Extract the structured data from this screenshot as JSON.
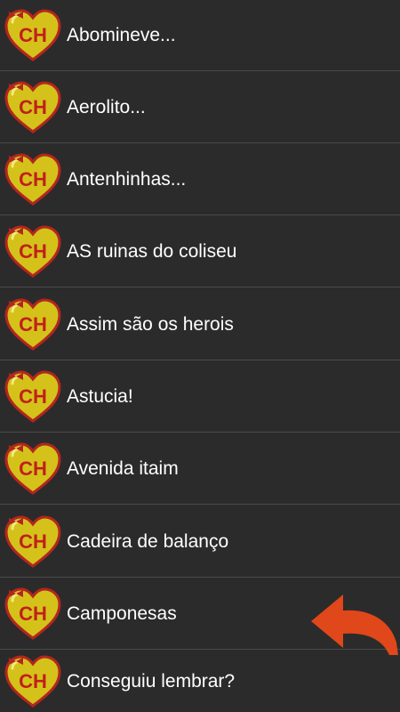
{
  "items": [
    {
      "label": "Abomineve...",
      "icon": "chapolin-heart-icon"
    },
    {
      "label": "Aerolito...",
      "icon": "chapolin-heart-icon"
    },
    {
      "label": "Antenhinhas...",
      "icon": "chapolin-heart-icon"
    },
    {
      "label": "AS ruinas do coliseu",
      "icon": "chapolin-heart-icon"
    },
    {
      "label": "Assim são os herois",
      "icon": "chapolin-heart-icon"
    },
    {
      "label": "Astucia!",
      "icon": "chapolin-heart-icon"
    },
    {
      "label": "Avenida itaim",
      "icon": "chapolin-heart-icon"
    },
    {
      "label": "Cadeira de balanço",
      "icon": "chapolin-heart-icon"
    },
    {
      "label": "Camponesas",
      "icon": "chapolin-heart-icon"
    },
    {
      "label": "Conseguiu lembrar?",
      "icon": "chapolin-heart-icon"
    }
  ],
  "icon_text": "CH",
  "colors": {
    "background": "#2b2b2b",
    "divider": "#4a4a4a",
    "heart_fill": "#d4c21a",
    "heart_outline": "#b3261e",
    "icon_letters": "#c0201a",
    "arrow": "#e0471a"
  },
  "overlay": {
    "icon": "curved-arrow-icon"
  }
}
